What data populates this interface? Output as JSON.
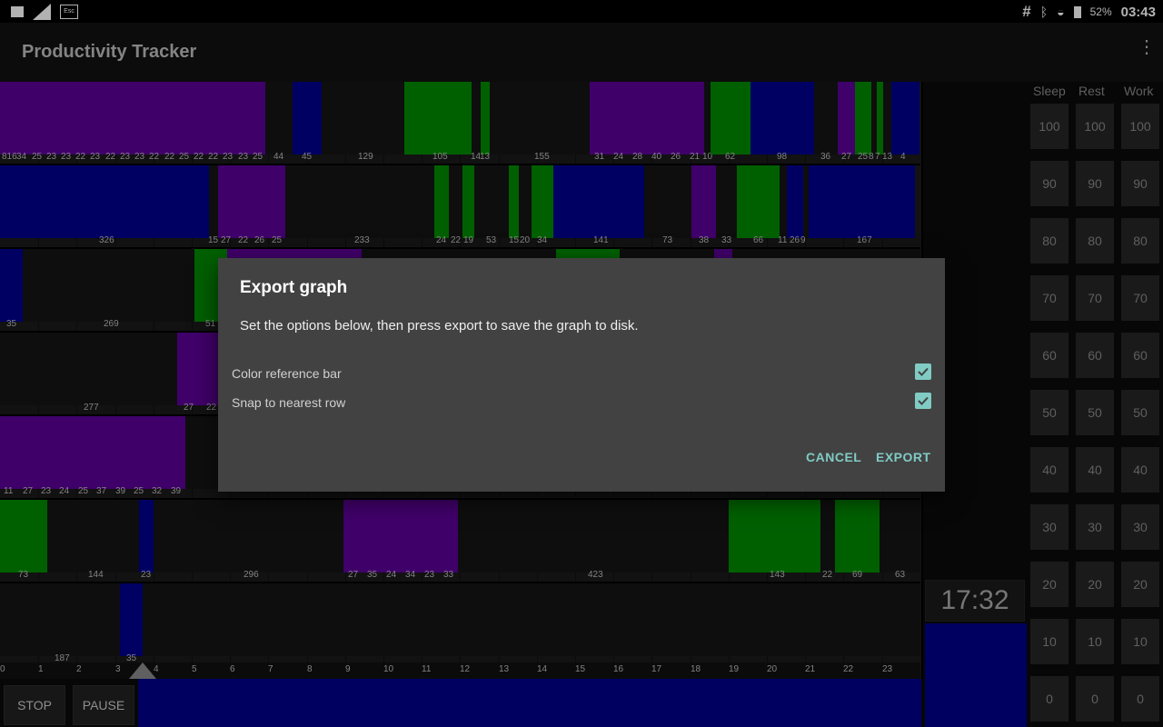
{
  "status": {
    "battery_pct": "52%",
    "time": "03:43",
    "hash_symbol": "#"
  },
  "appbar": {
    "title": "Productivity Tracker"
  },
  "graph": {
    "rows": [
      [
        {
          "c": "purple",
          "w": 292,
          "labels": [
            "816",
            "34",
            "25",
            "23",
            "23",
            "22",
            "23",
            "22",
            "23",
            "23",
            "22",
            "22",
            "25",
            "22",
            "22",
            "23",
            "23",
            "25"
          ]
        },
        {
          "c": "gray",
          "w": 30,
          "labels": [
            "44"
          ]
        },
        {
          "c": "blue",
          "w": 32,
          "labels": [
            "45"
          ]
        },
        {
          "c": "gray",
          "w": 91,
          "labels": [
            "129"
          ]
        },
        {
          "c": "green",
          "w": 74,
          "labels": [
            "105"
          ]
        },
        {
          "c": "gray",
          "w": 10,
          "labels": [
            "14"
          ]
        },
        {
          "c": "green",
          "w": 10,
          "labels": [
            "13"
          ]
        },
        {
          "c": "gray",
          "w": 110,
          "labels": [
            "155"
          ]
        },
        {
          "c": "purple",
          "w": 126,
          "labels": [
            "31",
            "24",
            "28",
            "40",
            "26",
            "21"
          ]
        },
        {
          "c": "gray",
          "w": 7,
          "labels": [
            "10"
          ]
        },
        {
          "c": "green",
          "w": 44,
          "labels": [
            "62"
          ]
        },
        {
          "c": "blue",
          "w": 70,
          "labels": [
            "98"
          ]
        },
        {
          "c": "gray",
          "w": 26,
          "labels": [
            "36"
          ]
        },
        {
          "c": "purple",
          "w": 19,
          "labels": [
            "27"
          ]
        },
        {
          "c": "green",
          "w": 18,
          "labels": [
            "25"
          ]
        },
        {
          "c": "gray",
          "w": 6,
          "labels": [
            "8"
          ]
        },
        {
          "c": "green",
          "w": 7,
          "labels": [
            "7"
          ]
        },
        {
          "c": "gray",
          "w": 9,
          "labels": [
            "13"
          ]
        },
        {
          "c": "blue",
          "w": 31,
          "labels": [
            "4"
          ]
        }
      ],
      [
        {
          "c": "blue",
          "w": 230,
          "labels": [
            "326"
          ]
        },
        {
          "c": "gray",
          "w": 10,
          "labels": [
            "15"
          ]
        },
        {
          "c": "purple",
          "w": 74,
          "labels": [
            "27",
            "22",
            "26",
            "25"
          ]
        },
        {
          "c": "gray",
          "w": 164,
          "labels": [
            "233"
          ]
        },
        {
          "c": "green",
          "w": 16,
          "labels": [
            "24"
          ]
        },
        {
          "c": "gray",
          "w": 15,
          "labels": [
            "22"
          ]
        },
        {
          "c": "green",
          "w": 13,
          "labels": [
            "19"
          ]
        },
        {
          "c": "gray",
          "w": 38,
          "labels": [
            "53"
          ]
        },
        {
          "c": "green",
          "w": 11,
          "labels": [
            "15"
          ]
        },
        {
          "c": "gray",
          "w": 14,
          "labels": [
            "20"
          ]
        },
        {
          "c": "green",
          "w": 24,
          "labels": [
            "34"
          ]
        },
        {
          "c": "blue",
          "w": 100,
          "labels": [
            "141"
          ]
        },
        {
          "c": "gray",
          "w": 52,
          "labels": [
            "73"
          ]
        },
        {
          "c": "purple",
          "w": 27,
          "labels": [
            "38"
          ]
        },
        {
          "c": "gray",
          "w": 23,
          "labels": [
            "33"
          ]
        },
        {
          "c": "green",
          "w": 47,
          "labels": [
            "66"
          ]
        },
        {
          "c": "gray",
          "w": 8,
          "labels": [
            "11"
          ]
        },
        {
          "c": "blue",
          "w": 18,
          "labels": [
            "26"
          ]
        },
        {
          "c": "gray",
          "w": 6,
          "labels": [
            "9"
          ]
        },
        {
          "c": "blue",
          "w": 117,
          "labels": [
            "167"
          ]
        }
      ],
      [
        {
          "c": "blue",
          "w": 25,
          "labels": [
            "35"
          ]
        },
        {
          "c": "gray",
          "w": 189,
          "labels": [
            "269"
          ]
        },
        {
          "c": "green",
          "w": 36,
          "labels": [
            "51"
          ]
        },
        {
          "c": "purple",
          "w": 148,
          "labels": []
        },
        {
          "c": "gray",
          "w": 214,
          "labels": []
        },
        {
          "c": "green",
          "w": 70,
          "labels": []
        },
        {
          "c": "gray",
          "w": 104,
          "labels": []
        },
        {
          "c": "purple",
          "w": 20,
          "labels": []
        },
        {
          "c": "gray",
          "w": 207,
          "labels": []
        }
      ],
      [
        {
          "c": "gray",
          "w": 195,
          "labels": [
            "277"
          ]
        },
        {
          "c": "purple",
          "w": 50,
          "labels": [
            "27",
            "22"
          ]
        },
        {
          "c": "gray",
          "w": 768,
          "labels": []
        }
      ],
      [
        {
          "c": "purple",
          "w": 204,
          "labels": [
            "11",
            "27",
            "23",
            "24",
            "25",
            "37",
            "39",
            "25",
            "32",
            "39"
          ]
        },
        {
          "c": "gray",
          "w": 809,
          "labels": []
        }
      ],
      [
        {
          "c": "green",
          "w": 52,
          "labels": [
            "73"
          ]
        },
        {
          "c": "gray",
          "w": 101,
          "labels": [
            "144"
          ]
        },
        {
          "c": "blue",
          "w": 16,
          "labels": [
            "23"
          ]
        },
        {
          "c": "gray",
          "w": 209,
          "labels": [
            "296"
          ]
        },
        {
          "c": "purple",
          "w": 126,
          "labels": [
            "27",
            "35",
            "24",
            "34",
            "23",
            "33"
          ]
        },
        {
          "c": "gray",
          "w": 298,
          "labels": [
            "423"
          ]
        },
        {
          "c": "green",
          "w": 101,
          "labels": [
            "143"
          ]
        },
        {
          "c": "gray",
          "w": 16,
          "labels": [
            "22"
          ]
        },
        {
          "c": "green",
          "w": 49,
          "labels": [
            "69"
          ]
        },
        {
          "c": "gray",
          "w": 45,
          "labels": [
            "63"
          ]
        }
      ],
      [
        {
          "c": "gray",
          "w": 132,
          "labels": [
            "187"
          ]
        },
        {
          "c": "blue",
          "w": 25,
          "labels": [
            "35"
          ]
        },
        {
          "c": "gray",
          "w": 856,
          "labels": []
        }
      ]
    ],
    "hours": [
      "0",
      "1",
      "2",
      "3",
      "4",
      "5",
      "6",
      "7",
      "8",
      "9",
      "10",
      "11",
      "12",
      "13",
      "14",
      "15",
      "16",
      "17",
      "18",
      "19",
      "20",
      "21",
      "22",
      "23"
    ]
  },
  "controls": {
    "stop": "STOP",
    "pause": "PAUSE",
    "timer": "17:32"
  },
  "side": {
    "headers": [
      "Sleep",
      "Rest",
      "Work"
    ],
    "values": [
      "100",
      "90",
      "80",
      "70",
      "60",
      "50",
      "40",
      "30",
      "20",
      "10",
      "0"
    ]
  },
  "dialog": {
    "title": "Export graph",
    "message": "Set the options below, then press export to save the graph to disk.",
    "options": [
      {
        "label": "Color reference bar",
        "checked": true
      },
      {
        "label": "Snap to nearest row",
        "checked": true
      }
    ],
    "cancel": "CANCEL",
    "export": "EXPORT"
  },
  "colors": {
    "purple": "#5c0099",
    "blue": "#00008f",
    "green": "#008a00",
    "accent": "#80cbc4"
  }
}
